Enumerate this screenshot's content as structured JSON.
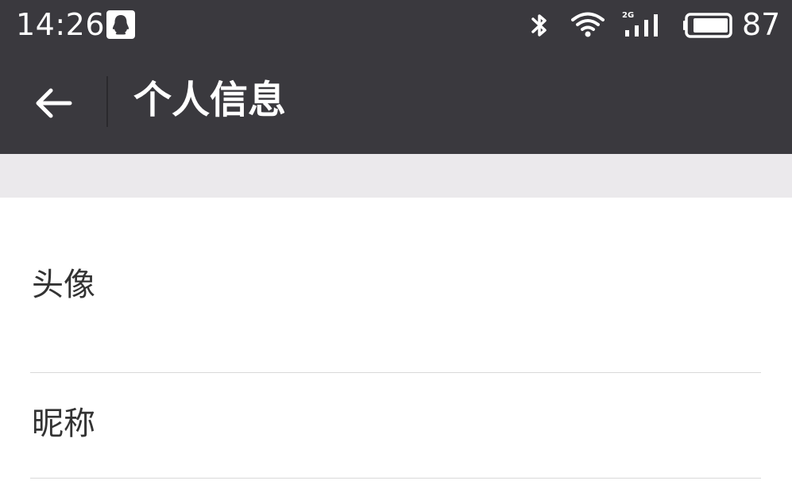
{
  "status_bar": {
    "time": "14:26",
    "battery_level": "87",
    "network_type": "2G",
    "icons": [
      "qq-icon",
      "bluetooth-icon",
      "wifi-icon",
      "signal-icon",
      "battery-icon"
    ]
  },
  "app_bar": {
    "title": "个人信息",
    "back_icon": "back-arrow-icon"
  },
  "list": {
    "items": [
      {
        "label": "头像"
      },
      {
        "label": "昵称"
      }
    ]
  },
  "colors": {
    "bar_background": "#3a393e",
    "section_gap": "#ebe9ec",
    "divider": "#d9d9d9",
    "text_primary": "#333333"
  }
}
